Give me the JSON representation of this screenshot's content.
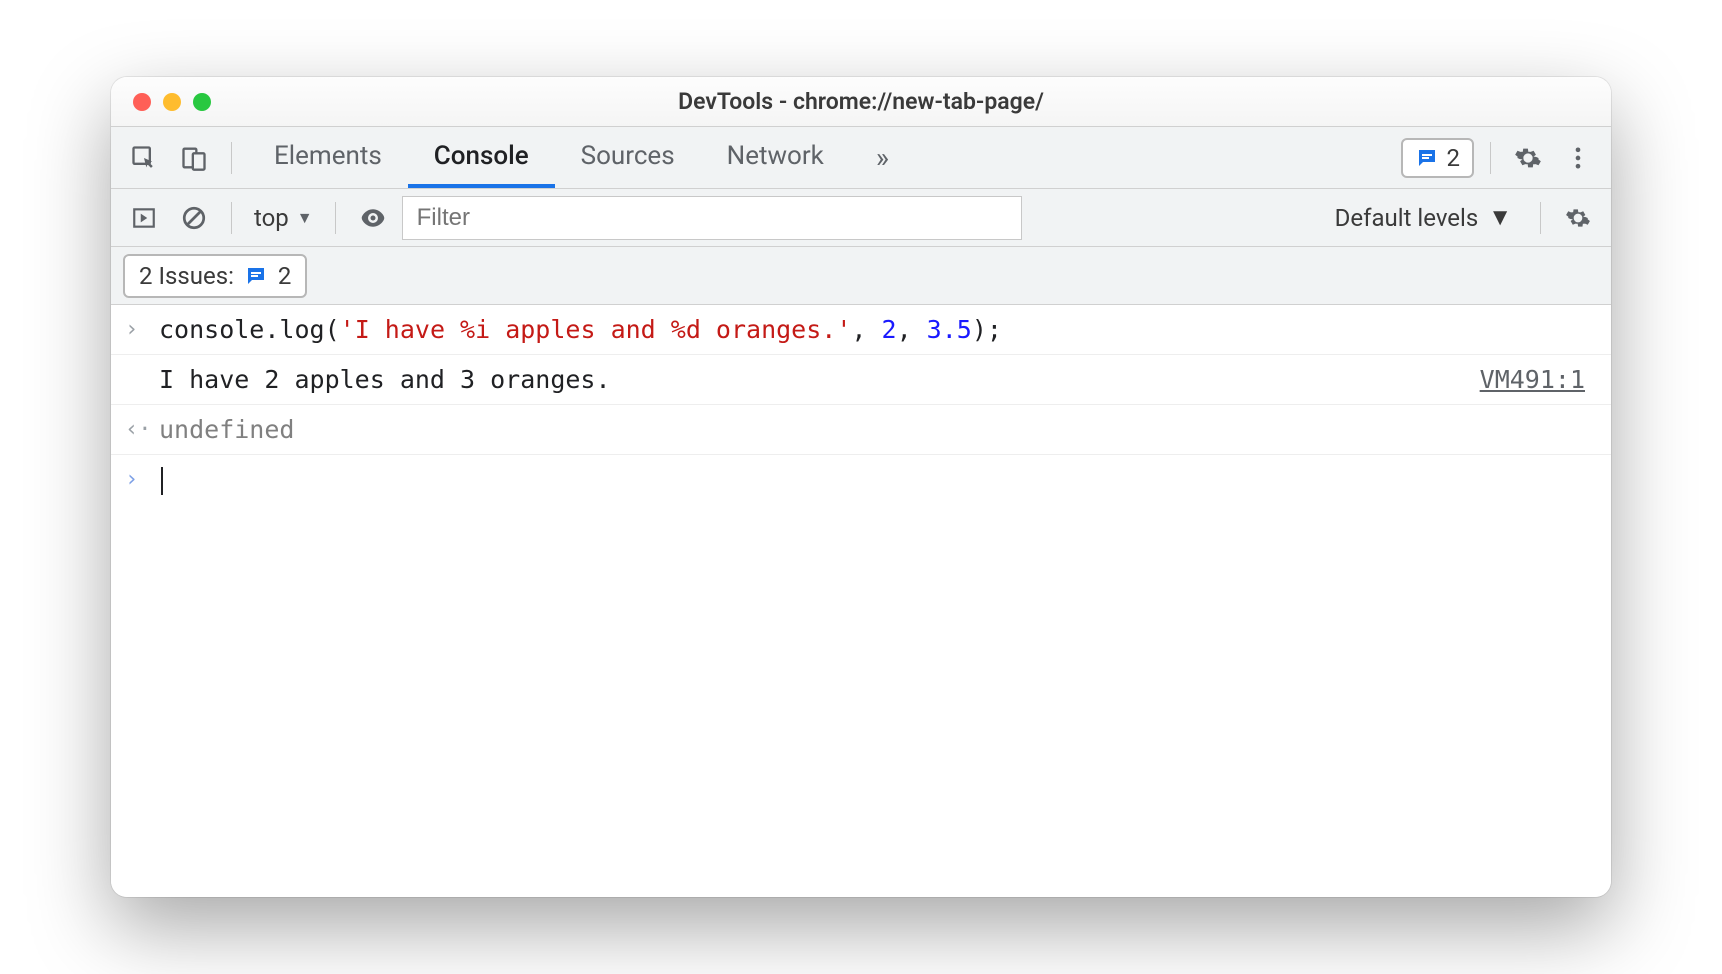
{
  "window": {
    "title": "DevTools - chrome://new-tab-page/"
  },
  "tabs": {
    "items": [
      "Elements",
      "Console",
      "Sources",
      "Network"
    ],
    "active": "Console",
    "more_glyph": "»"
  },
  "issues_badge": {
    "count": "2"
  },
  "toolbar": {
    "context": "top",
    "filter_placeholder": "Filter",
    "levels_label": "Default levels"
  },
  "issues_chip": {
    "label": "2 Issues:",
    "count": "2"
  },
  "console": {
    "rows": [
      {
        "type": "input",
        "gutter": "›",
        "code": {
          "ident": "console",
          "dot": ".",
          "method": "log",
          "open": "(",
          "str": "'I have %i apples and %d oranges.'",
          "c1": ", ",
          "n1": "2",
          "c2": ", ",
          "n2": "3.5",
          "close": ")",
          "semi": ";"
        }
      },
      {
        "type": "output",
        "gutter": "",
        "text": "I have 2 apples and 3 oranges.",
        "source": "VM491:1"
      },
      {
        "type": "return",
        "gutter": "‹·",
        "text": "undefined"
      },
      {
        "type": "prompt",
        "gutter": "›"
      }
    ]
  }
}
